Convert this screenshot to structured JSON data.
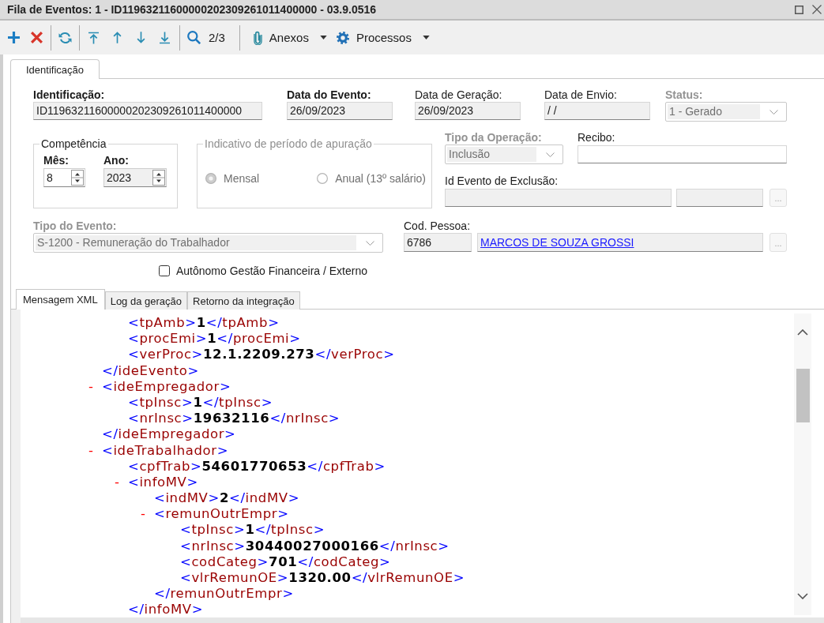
{
  "window": {
    "title": "Fila de Eventos: 1 - ID11963211600000202309261011400000 - 03.9.0516"
  },
  "toolbar": {
    "record_counter": "2/3",
    "menus": [
      {
        "label": "Anexos"
      },
      {
        "label": "Processos"
      }
    ]
  },
  "tabs": [
    {
      "label": "Identificação",
      "selected": true
    }
  ],
  "form": {
    "identificacao": {
      "kind": "text",
      "label": "Identificação:",
      "value": "ID11963211600000202309261011400000",
      "required": true,
      "readonly": true
    },
    "data_do_evento": {
      "kind": "text",
      "label": "Data do Evento:",
      "value": "26/09/2023",
      "required": true,
      "readonly": true
    },
    "data_de_geracao": {
      "kind": "text",
      "label": "Data de Geração:",
      "value": "26/09/2023",
      "required": false,
      "readonly": true
    },
    "data_de_envio": {
      "kind": "text",
      "label": "Data de Envio:",
      "value": "/ /",
      "required": false,
      "readonly": true
    },
    "status": {
      "kind": "dropdown",
      "label": "Status:",
      "value": "1 - Gerado",
      "required": true,
      "disabled": true
    },
    "competencia": {
      "title": "Competência",
      "mes": {
        "label": "Mês:",
        "value": "8",
        "required": true,
        "readonly": false
      },
      "ano": {
        "label": "Ano:",
        "value": "2023",
        "required": true,
        "readonly": true
      }
    },
    "indicativo": {
      "title": "Indicativo de período de apuração",
      "disabled": true,
      "options": [
        {
          "label": "Mensal",
          "selected": true
        },
        {
          "label": "Anual (13º salário)",
          "selected": false
        }
      ]
    },
    "tipo_da_operacao": {
      "kind": "dropdown",
      "label": "Tipo da Operação:",
      "value": "Inclusão",
      "required": true,
      "disabled": true
    },
    "recibo": {
      "kind": "text",
      "label": "Recibo:",
      "required": false,
      "readonly": false
    },
    "id_evento_de_exclusao": {
      "label": "Id Evento de Exclusão:",
      "required": false,
      "readonly": true,
      "lookup": {
        "label": "...",
        "disabled": true
      }
    },
    "tipo_do_evento": {
      "kind": "dropdown",
      "label": "Tipo do Evento:",
      "value": "S-1200 - Remuneração do Trabalhador",
      "required": true,
      "disabled": true
    },
    "cod_pessoa": {
      "label": "Cod. Pessoa:",
      "value": "6786",
      "name": "MARCOS DE SOUZA GROSSI",
      "required": false,
      "readonly": true,
      "lookup": {
        "label": "...",
        "disabled": true
      }
    },
    "autonomo": {
      "label": "Autônomo Gestão Financeira / Externo",
      "checked": false
    }
  },
  "xml_tabs": [
    {
      "label": "Mensagem XML",
      "selected": true
    },
    {
      "label": "Log da geração",
      "selected": false
    },
    {
      "label": "Retorno da integração",
      "selected": false
    }
  ],
  "xml_view": {
    "nodes": [
      {
        "kind": "element",
        "close": "</ideEvento>",
        "children": [
          {
            "kind": "leaf",
            "open": "<tpAmb>",
            "value": "1",
            "close": "</tpAmb>"
          },
          {
            "kind": "leaf",
            "open": "<procEmi>",
            "value": "1",
            "close": "</procEmi>"
          },
          {
            "kind": "leaf",
            "open": "<verProc>",
            "value": "12.1.2209.273",
            "close": "</verProc>"
          }
        ]
      },
      {
        "kind": "element",
        "toggle": "-",
        "expanded": true,
        "open": "<ideEmpregador>",
        "close": "</ideEmpregador>",
        "children": [
          {
            "kind": "leaf",
            "open": "<tpInsc>",
            "value": "1",
            "close": "</tpInsc>"
          },
          {
            "kind": "leaf",
            "open": "<nrInsc>",
            "value": "19632116",
            "close": "</nrInsc>"
          }
        ]
      },
      {
        "kind": "element",
        "toggle": "-",
        "expanded": true,
        "open": "<ideTrabalhador>",
        "children": [
          {
            "kind": "leaf",
            "open": "<cpfTrab>",
            "value": "54601770653",
            "close": "</cpfTrab>"
          },
          {
            "kind": "element",
            "toggle": "-",
            "expanded": true,
            "open": "<infoMV>",
            "close": "</infoMV>",
            "children": [
              {
                "kind": "leaf",
                "open": "<indMV>",
                "value": "2",
                "close": "</indMV>"
              },
              {
                "kind": "element",
                "toggle": "-",
                "expanded": true,
                "open": "<remunOutrEmpr>",
                "close": "</remunOutrEmpr>",
                "children": [
                  {
                    "kind": "leaf",
                    "open": "<tpInsc>",
                    "value": "1",
                    "close": "</tpInsc>"
                  },
                  {
                    "kind": "leaf",
                    "open": "<nrInsc>",
                    "value": "30440027000166",
                    "close": "</nrInsc>"
                  },
                  {
                    "kind": "leaf",
                    "open": "<codCateg>",
                    "value": "701",
                    "close": "</codCateg>"
                  },
                  {
                    "kind": "leaf",
                    "open": "<vlrRemunOE>",
                    "value": "1320.00",
                    "close": "</vlrRemunOE>"
                  }
                ]
              }
            ]
          }
        ]
      }
    ]
  }
}
